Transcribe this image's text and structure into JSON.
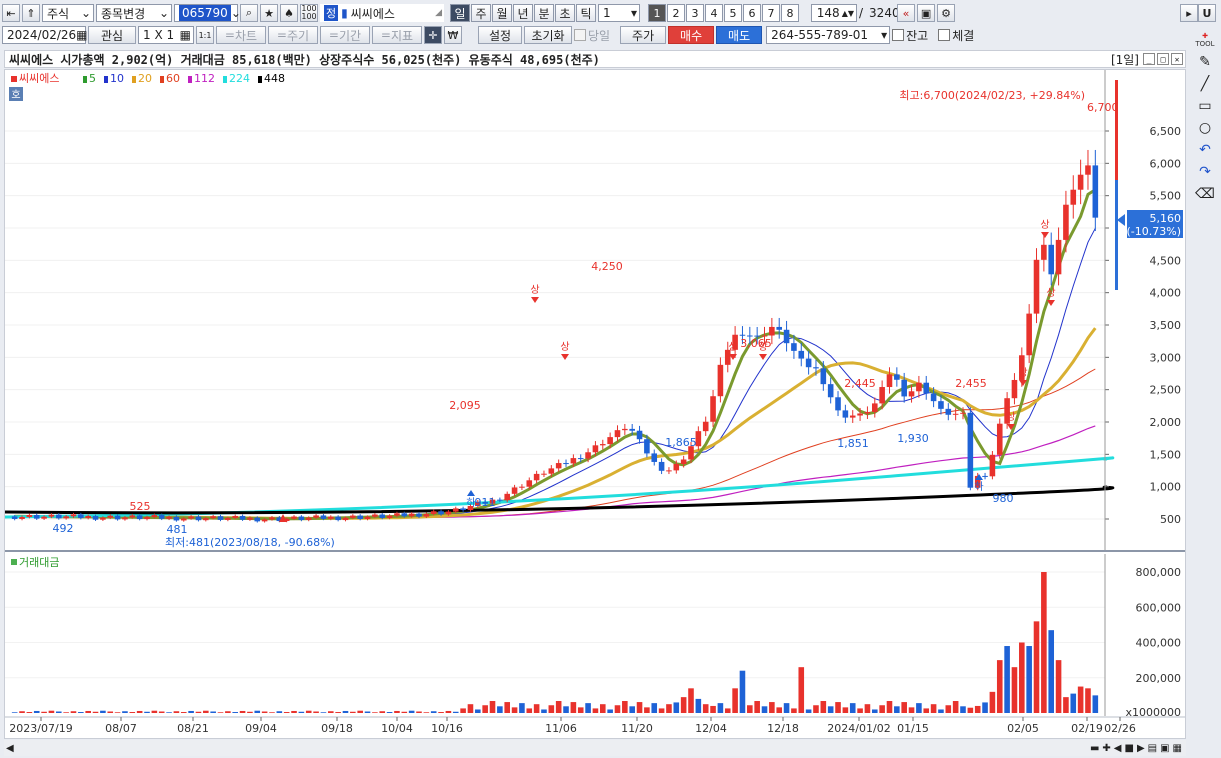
{
  "toolbar1": {
    "market": "주식",
    "change_label": "종목변경",
    "code": "065790",
    "stock_badge": "정",
    "stock_name": "씨씨에스",
    "timeframes": [
      "일",
      "주",
      "월",
      "년",
      "분",
      "초",
      "틱"
    ],
    "tf_active": "일",
    "interval_value": "1",
    "pages": [
      "1",
      "2",
      "3",
      "4",
      "5",
      "6",
      "7",
      "8"
    ],
    "page_active": "1",
    "count_value": "148",
    "count_sep": "/",
    "total_value": "3240"
  },
  "toolbar2": {
    "date": "2024/02/26",
    "watch_label": "관심",
    "grid_label": "1 X 1",
    "grid_small": "1:1",
    "tabs": [
      "차트",
      "주기",
      "기간",
      "지표"
    ],
    "settings_label": "설정",
    "reset_label": "초기화",
    "today_label": "당일",
    "price_label": "주가",
    "buy_label": "매수",
    "sell_label": "매도",
    "account": "264-555-789-01",
    "balance_label": "잔고",
    "filled_label": "체결"
  },
  "infobar": {
    "text": "씨씨에스  시가총액 2,902(억) 거래대금 85,618(백만) 상장주식수 56,025(천주) 유동주식 48,695(천주)",
    "period": "[1일]"
  },
  "legend": {
    "name": "씨씨에스",
    "ma": [
      {
        "label": "5",
        "color": "#2e9b2e"
      },
      {
        "label": "10",
        "color": "#2233cc"
      },
      {
        "label": "20",
        "color": "#e0a020"
      },
      {
        "label": "60",
        "color": "#e04020"
      },
      {
        "label": "112",
        "color": "#c020c0"
      },
      {
        "label": "224",
        "color": "#22dddd"
      },
      {
        "label": "448",
        "color": "#000000"
      }
    ],
    "ho": "호"
  },
  "price_panel": {
    "y_ticks": [
      "6,500",
      "6,000",
      "5,500",
      "5,000",
      "4,500",
      "4,000",
      "3,500",
      "3,000",
      "2,500",
      "2,000",
      "1,500",
      "1,000",
      "500"
    ],
    "current_price": "5,160",
    "current_change": "(-10.73%)",
    "high_note": "최고:6,700(2024/02/23, +29.84%)",
    "high_value": "6,700",
    "low_note": "최저:481(2023/08/18, -90.68%)",
    "labels": [
      "492",
      "525",
      "481",
      "2,095",
      "4,250",
      "1,865",
      "3,065",
      "2,445",
      "1,851",
      "1,930",
      "2,455",
      "980",
      "911"
    ],
    "sang": "상",
    "ha": "하"
  },
  "volume_panel": {
    "title": "거래대금",
    "y_ticks": [
      "800,000",
      "600,000",
      "400,000",
      "200,000"
    ],
    "unit": "x1000000"
  },
  "x_axis": [
    "2023/07/19",
    "08/07",
    "08/21",
    "09/04",
    "09/18",
    "10/04",
    "10/16",
    "11/06",
    "11/20",
    "12/04",
    "12/18",
    "2024/01/02",
    "01/15",
    "02/05",
    "02/19",
    "02/26"
  ],
  "sidebar": {
    "tool_label": "TOOL"
  },
  "colors": {
    "up": "#e8322c",
    "down": "#1e62d6",
    "ma5": "#7a9a2e",
    "ma20": "#d9b032"
  }
}
